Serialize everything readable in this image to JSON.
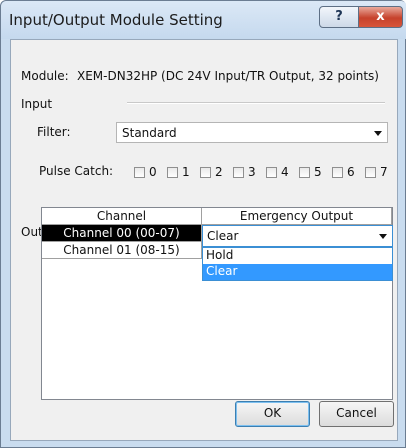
{
  "window": {
    "title": "Input/Output Module Setting",
    "help_label": "?",
    "close_label": "x"
  },
  "module": {
    "label": "Module:",
    "value": "XEM-DN32HP (DC 24V Input/TR Output, 32 points)"
  },
  "input": {
    "section_label": "Input",
    "filter_label": "Filter:",
    "filter_value": "Standard",
    "pulse_catch_label": "Pulse Catch:",
    "pulse_catch_items": [
      "0",
      "1",
      "2",
      "3",
      "4",
      "5",
      "6",
      "7"
    ]
  },
  "output": {
    "section_label": "Output",
    "columns": [
      "Channel",
      "Emergency Output"
    ],
    "rows": [
      {
        "channel": "Channel 00 (00-07)",
        "emergency": "Clear"
      },
      {
        "channel": "Channel 01 (08-15)",
        "emergency": ""
      }
    ],
    "dropdown_options": [
      "Hold",
      "Clear"
    ],
    "dropdown_selected": "Clear"
  },
  "buttons": {
    "ok": "OK",
    "cancel": "Cancel"
  }
}
